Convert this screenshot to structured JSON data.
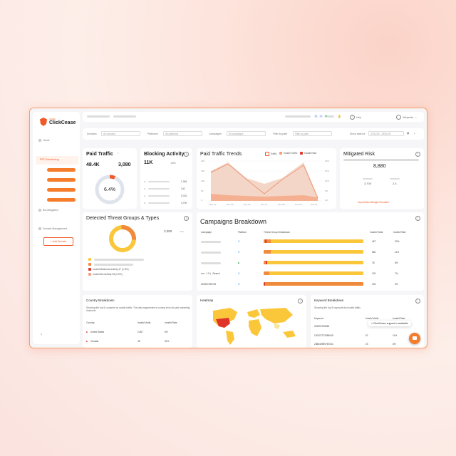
{
  "brand": {
    "small": "CHEQ",
    "name": "ClickCease"
  },
  "sidebar": {
    "home": "Home",
    "active": "PPC Monitoring",
    "bot_mitigation": "Bot Mitigation",
    "domain_management": "Domain Management",
    "add_domain": "+ Add Domain",
    "collapse": "‹"
  },
  "topbar": {
    "help": "Help",
    "user": "Wikipedia"
  },
  "filters": {
    "domains_label": "Domains",
    "domains_value": "All domains",
    "platforms_label": "Platforms",
    "platforms_value": "All platforms",
    "campaigns_label": "Campaigns",
    "campaigns_value": "All campaigns",
    "path_label": "Filter by path",
    "path_placeholder": "Filter by path",
    "date_label": "Show data for",
    "date_value": "24/11/25 - 29/01/25"
  },
  "paid_traffic": {
    "title": "Paid Traffic",
    "total": "48.4K",
    "invalid": "3,080",
    "percent": "6.4%"
  },
  "blocking": {
    "title": "Blocking Activity",
    "value": "11K",
    "change": "-63%",
    "rows": [
      "1,354",
      "142",
      "5,762",
      "3,700"
    ]
  },
  "trends": {
    "title": "Paid Traffic Trends",
    "legend": [
      "Traffic",
      "Invalid Traffic",
      "Invalid Rate"
    ],
    "y_left": [
      "20K",
      "15K",
      "10K",
      "5K",
      "0"
    ],
    "y_right": [
      "20%",
      "15%",
      "10%",
      "5%",
      "0%"
    ],
    "x_labels": [
      "Nov 24",
      "Nov 25",
      "Nov 26",
      "Nov 27",
      "Nov 28",
      "Nov 29",
      "Dec 01"
    ]
  },
  "mitigated": {
    "title": "Mitigated Risk",
    "value": "8,880",
    "left": "3,700",
    "right": "2.4",
    "link": "Unprotected Budget Simulator"
  },
  "threats": {
    "title": "Detected Threat Groups & Types",
    "total": "3,080",
    "delta": "11%",
    "legend": [
      "Invalid Malicious Activity 47 (1.5%)",
      "Invalid Bot Activity 28 (0.9%)"
    ]
  },
  "campaigns": {
    "title": "Campaigns Breakdown",
    "headers": [
      "Campaign",
      "Platform",
      "Threat Group Breakdown",
      "Invalid Visits",
      "Invalid Rate"
    ],
    "rows": [
      {
        "name": "",
        "visits": "457",
        "rate": "23%"
      },
      {
        "name": "",
        "visits": "582",
        "rate": "11%"
      },
      {
        "name": "",
        "visits": "78",
        "rate": "8%"
      },
      {
        "name": "run - 1 5 | - Search",
        "visits": "120",
        "rate": "7%"
      },
      {
        "name": "691557295782",
        "visits": "225",
        "rate": "3%"
      }
    ]
  },
  "country": {
    "title": "Country Breakdown",
    "desc": "Showing the top 5 countries by invalid traffic. The data segmented is coming from all paid marketing channels.",
    "headers": [
      "Country",
      "Invalid Visits",
      "Invalid Rate"
    ],
    "rows": [
      {
        "name": "United States",
        "visits": "2,807",
        "rate": "6%"
      },
      {
        "name": "Canada",
        "visits": "45",
        "rate": "31%"
      }
    ]
  },
  "heatmap": {
    "title": "Heatmap"
  },
  "keyword": {
    "title": "Keyword Breakdown",
    "desc": "Showing the top 5 keywords by invalid traffic.",
    "headers": [
      "Keyword",
      "Invalid Visits",
      "Invalid Rate"
    ],
    "rows": [
      {
        "name": "091557226582",
        "visits": "",
        "rate": ""
      },
      {
        "name": "120207273389045",
        "visits": "57",
        "rate": "11%"
      },
      {
        "name": "238540959787044",
        "visits": "23",
        "rate": "6%"
      }
    ],
    "chat": "ClickCease support is available"
  }
}
